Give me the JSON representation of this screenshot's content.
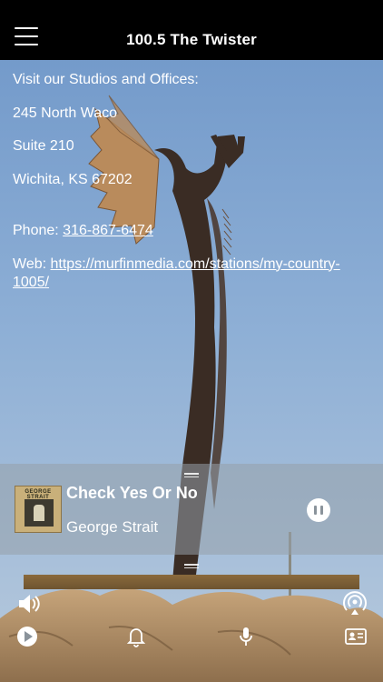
{
  "header": {
    "title": "100.5 The Twister",
    "menu_icon": "hamburger-menu-icon"
  },
  "info": {
    "intro": "Visit our Studios and Offices:",
    "address_line1": "245 North Waco",
    "address_line2": "Suite 210",
    "address_line3": "Wichita, KS 67202",
    "phone_label": "Phone:",
    "phone_value": "316-867-6474",
    "web_label": "Web:",
    "web_value": "https://murfinmedia.com/stations/my-country-1005/"
  },
  "now_playing": {
    "song_title": "Check Yes Or No",
    "artist": "George Strait",
    "album_art_label": "GEORGE STRAIT",
    "state": "playing"
  },
  "controls": {
    "volume_icon": "speaker-volume-icon",
    "airplay_icon": "airplay-broadcast-icon",
    "play_icon": "play-circle-icon",
    "alarm_icon": "bell-icon",
    "record_icon": "microphone-icon",
    "contact_icon": "contact-card-icon",
    "pause_icon": "pause-icon"
  },
  "colors": {
    "header_bg": "#000000",
    "text": "#ffffff",
    "player_overlay": "rgba(150,160,170,0.55)"
  }
}
